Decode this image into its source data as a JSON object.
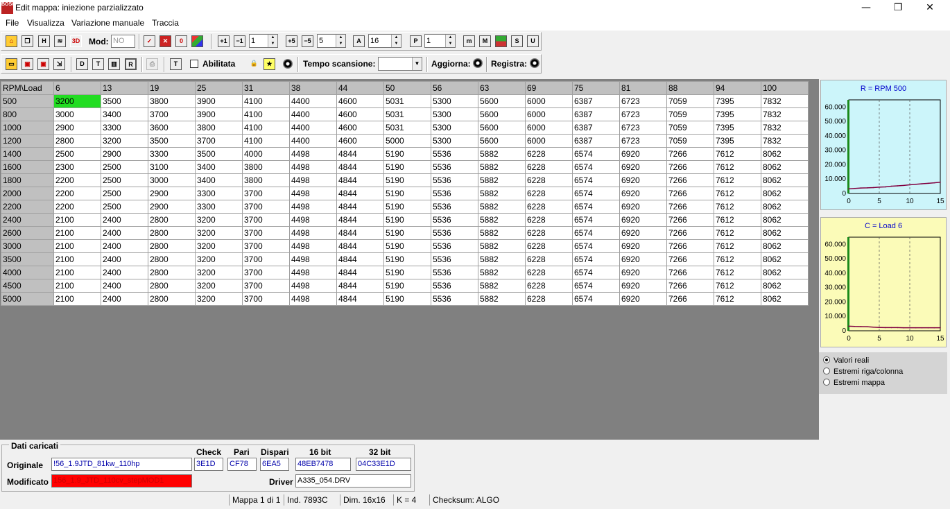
{
  "window": {
    "title": "Edit mappa: iniezione parzializzato",
    "logo_text": "BOSCH",
    "min": "—",
    "max": "❐",
    "close": "✕"
  },
  "menu": [
    "File",
    "Visualizza",
    "Variazione manuale",
    "Traccia"
  ],
  "toolbar1": {
    "mod_label": "Mod:",
    "mod_value": "NO",
    "spin1": "1",
    "spin2": "5",
    "spin3": "16",
    "spin4": "1",
    "icons": [
      "home-icon",
      "windows-icon",
      "table-icon",
      "graph-icon",
      "3d-icon",
      "check-icon",
      "x-icon",
      "zero-icon",
      "colors-icon",
      "plus1-icon",
      "minus1-icon",
      "plus5-icon",
      "minus5-icon",
      "a-icon",
      "p-icon",
      "m-small-icon",
      "m-icon",
      "image-icon",
      "s-icon",
      "u-icon"
    ]
  },
  "toolbar2": {
    "abilitata": "Abilitata",
    "tempo": "Tempo scansione:",
    "aggiorna": "Aggiorna:",
    "registra": "Registra:"
  },
  "grid": {
    "corner": "RPM\\Load",
    "cols": [
      "6",
      "13",
      "19",
      "25",
      "31",
      "38",
      "44",
      "50",
      "56",
      "63",
      "69",
      "75",
      "81",
      "88",
      "94",
      "100"
    ],
    "rows": [
      {
        "rpm": "500",
        "v": [
          "3200",
          "3500",
          "3800",
          "3900",
          "4100",
          "4400",
          "4600",
          "5031",
          "5300",
          "5600",
          "6000",
          "6387",
          "6723",
          "7059",
          "7395",
          "7832"
        ]
      },
      {
        "rpm": "800",
        "v": [
          "3000",
          "3400",
          "3700",
          "3900",
          "4100",
          "4400",
          "4600",
          "5031",
          "5300",
          "5600",
          "6000",
          "6387",
          "6723",
          "7059",
          "7395",
          "7832"
        ]
      },
      {
        "rpm": "1000",
        "v": [
          "2900",
          "3300",
          "3600",
          "3800",
          "4100",
          "4400",
          "4600",
          "5031",
          "5300",
          "5600",
          "6000",
          "6387",
          "6723",
          "7059",
          "7395",
          "7832"
        ]
      },
      {
        "rpm": "1200",
        "v": [
          "2800",
          "3200",
          "3500",
          "3700",
          "4100",
          "4400",
          "4600",
          "5000",
          "5300",
          "5600",
          "6000",
          "6387",
          "6723",
          "7059",
          "7395",
          "7832"
        ]
      },
      {
        "rpm": "1400",
        "v": [
          "2500",
          "2900",
          "3300",
          "3500",
          "4000",
          "4498",
          "4844",
          "5190",
          "5536",
          "5882",
          "6228",
          "6574",
          "6920",
          "7266",
          "7612",
          "8062"
        ]
      },
      {
        "rpm": "1600",
        "v": [
          "2300",
          "2500",
          "3100",
          "3400",
          "3800",
          "4498",
          "4844",
          "5190",
          "5536",
          "5882",
          "6228",
          "6574",
          "6920",
          "7266",
          "7612",
          "8062"
        ]
      },
      {
        "rpm": "1800",
        "v": [
          "2200",
          "2500",
          "3000",
          "3400",
          "3800",
          "4498",
          "4844",
          "5190",
          "5536",
          "5882",
          "6228",
          "6574",
          "6920",
          "7266",
          "7612",
          "8062"
        ]
      },
      {
        "rpm": "2000",
        "v": [
          "2200",
          "2500",
          "2900",
          "3300",
          "3700",
          "4498",
          "4844",
          "5190",
          "5536",
          "5882",
          "6228",
          "6574",
          "6920",
          "7266",
          "7612",
          "8062"
        ]
      },
      {
        "rpm": "2200",
        "v": [
          "2200",
          "2500",
          "2900",
          "3300",
          "3700",
          "4498",
          "4844",
          "5190",
          "5536",
          "5882",
          "6228",
          "6574",
          "6920",
          "7266",
          "7612",
          "8062"
        ]
      },
      {
        "rpm": "2400",
        "v": [
          "2100",
          "2400",
          "2800",
          "3200",
          "3700",
          "4498",
          "4844",
          "5190",
          "5536",
          "5882",
          "6228",
          "6574",
          "6920",
          "7266",
          "7612",
          "8062"
        ]
      },
      {
        "rpm": "2600",
        "v": [
          "2100",
          "2400",
          "2800",
          "3200",
          "3700",
          "4498",
          "4844",
          "5190",
          "5536",
          "5882",
          "6228",
          "6574",
          "6920",
          "7266",
          "7612",
          "8062"
        ]
      },
      {
        "rpm": "3000",
        "v": [
          "2100",
          "2400",
          "2800",
          "3200",
          "3700",
          "4498",
          "4844",
          "5190",
          "5536",
          "5882",
          "6228",
          "6574",
          "6920",
          "7266",
          "7612",
          "8062"
        ]
      },
      {
        "rpm": "3500",
        "v": [
          "2100",
          "2400",
          "2800",
          "3200",
          "3700",
          "4498",
          "4844",
          "5190",
          "5536",
          "5882",
          "6228",
          "6574",
          "6920",
          "7266",
          "7612",
          "8062"
        ]
      },
      {
        "rpm": "4000",
        "v": [
          "2100",
          "2400",
          "2800",
          "3200",
          "3700",
          "4498",
          "4844",
          "5190",
          "5536",
          "5882",
          "6228",
          "6574",
          "6920",
          "7266",
          "7612",
          "8062"
        ]
      },
      {
        "rpm": "4500",
        "v": [
          "2100",
          "2400",
          "2800",
          "3200",
          "3700",
          "4498",
          "4844",
          "5190",
          "5536",
          "5882",
          "6228",
          "6574",
          "6920",
          "7266",
          "7612",
          "8062"
        ]
      },
      {
        "rpm": "5000",
        "v": [
          "2100",
          "2400",
          "2800",
          "3200",
          "3700",
          "4498",
          "4844",
          "5190",
          "5536",
          "5882",
          "6228",
          "6574",
          "6920",
          "7266",
          "7612",
          "8062"
        ]
      }
    ],
    "selected_cell_color": "#22dd22"
  },
  "chart_data": [
    {
      "type": "line",
      "title": "R = RPM 500",
      "x": [
        0,
        1,
        2,
        3,
        4,
        5,
        6,
        7,
        8,
        9,
        10,
        11,
        12,
        13,
        14,
        15
      ],
      "series": [
        {
          "values": [
            3200,
            3500,
            3800,
            3900,
            4100,
            4400,
            4600,
            5031,
            5300,
            5600,
            6000,
            6387,
            6723,
            7059,
            7395,
            7832
          ]
        }
      ],
      "yticks": [
        "0",
        "10.000",
        "20.000",
        "30.000",
        "40.000",
        "50.000",
        "60.000"
      ],
      "xticks": [
        "0",
        "5",
        "10",
        "15"
      ],
      "ylim": [
        0,
        65000
      ],
      "xlim": [
        0,
        15
      ],
      "bg": "#ccf5fa"
    },
    {
      "type": "line",
      "title": "C = Load 6",
      "x": [
        0,
        1,
        2,
        3,
        4,
        5,
        6,
        7,
        8,
        9,
        10,
        11,
        12,
        13,
        14,
        15
      ],
      "series": [
        {
          "values": [
            3200,
            3000,
            2900,
            2800,
            2500,
            2300,
            2200,
            2200,
            2200,
            2100,
            2100,
            2100,
            2100,
            2100,
            2100,
            2100
          ]
        }
      ],
      "yticks": [
        "0",
        "10.000",
        "20.000",
        "30.000",
        "40.000",
        "50.000",
        "60.000"
      ],
      "xticks": [
        "0",
        "5",
        "10",
        "15"
      ],
      "ylim": [
        0,
        65000
      ],
      "xlim": [
        0,
        15
      ],
      "bg": "#fbfbb8"
    }
  ],
  "view_options": {
    "items": [
      "Valori reali",
      "Estremi riga/colonna",
      "Estremi mappa"
    ],
    "selected": 0
  },
  "dati": {
    "title": "Dati caricati",
    "originale_label": "Originale",
    "modificato_label": "Modificato",
    "originale": "!56_1.9JTD_81kw_110hp",
    "modificato": "156_1.9_JTD_110cv_stepMOD1",
    "check_h": "Check",
    "pari_h": "Pari",
    "dispari_h": "Dispari",
    "b16_h": "16 bit",
    "b32_h": "32 bit",
    "check": "3E1D",
    "pari": "CF78",
    "dispari": "6EA5",
    "b16": "48EB7478",
    "b32": "04C33E1D",
    "driver_label": "Driver",
    "driver": "A335_054.DRV"
  },
  "status": {
    "mappa": "Mappa 1 di 1",
    "ind": "Ind. 7893C",
    "dim": "Dim. 16x16",
    "k": "K = 4",
    "checksum": "Checksum: ALGO"
  }
}
